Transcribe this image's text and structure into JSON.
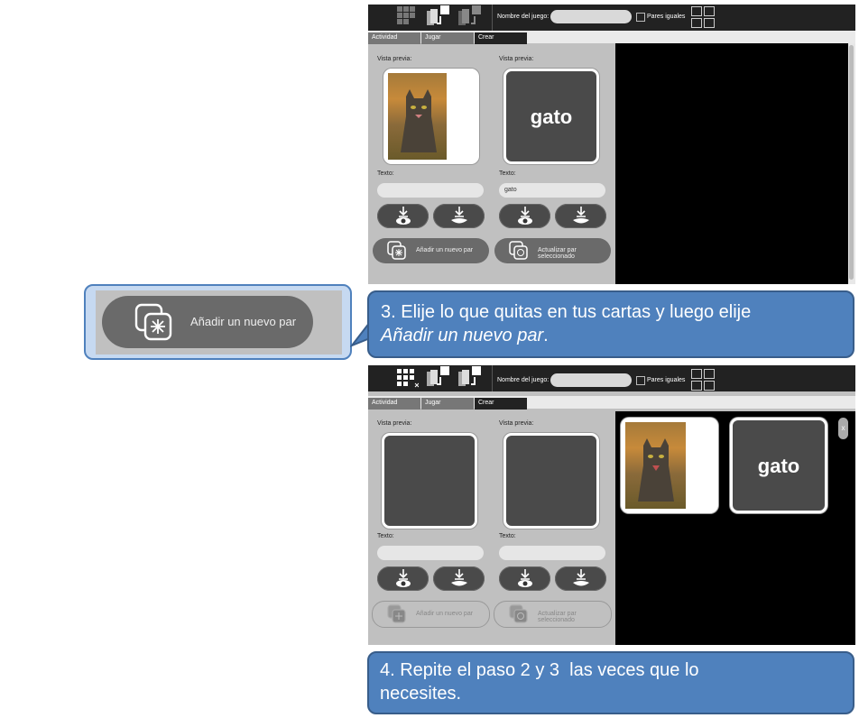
{
  "toolbar": {
    "tabs": [
      "Actividad",
      "Jugar",
      "Crear"
    ],
    "game_name_label": "Nombre del juego:",
    "pares_label": "Pares iguales"
  },
  "top_panel": {
    "left_preview_label": "Vista previa:",
    "right_preview_label": "Vista previa:",
    "left_text_label": "Texto:",
    "right_text_label": "Texto:",
    "left_text_value": "",
    "right_text_value": "gato",
    "card_word": "gato",
    "add_pair_label": "Añadir un nuevo par",
    "update_pair_label": "Actualizar par seleccionado"
  },
  "zoom": {
    "add_pair_label": "Añadir un nuevo par"
  },
  "callout3": {
    "text": "3. Elije lo que quitas en tus cartas y luego elije ",
    "italic": "Añadir un nuevo par",
    "end": "."
  },
  "bottom_panel": {
    "left_preview_label": "Vista previa:",
    "right_preview_label": "Vista previa:",
    "left_text_label": "Texto:",
    "right_text_label": "Texto:",
    "card_word": "gato",
    "close_label": "x",
    "add_pair_label": "Añadir un nuevo par",
    "update_pair_label": "Actualizar par seleccionado"
  },
  "callout4": {
    "line1": "4. Repite el paso 2 y 3  las veces que lo",
    "line2": "necesites."
  },
  "colors": {
    "callout_fill": "#4f81bd",
    "callout_border": "#385d8a",
    "panel_gray": "#c0c0c0",
    "toolbar": "#222222"
  }
}
